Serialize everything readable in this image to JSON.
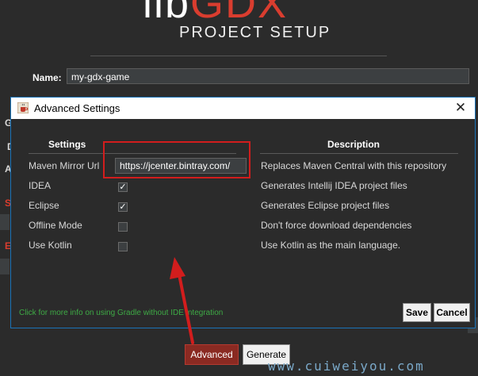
{
  "header": {
    "logo_part1": "lib",
    "logo_part2": "GDX",
    "subtitle": "PROJECT SETUP"
  },
  "form": {
    "name_label": "Name:",
    "name_value": "my-gdx-game",
    "obscured_letters": [
      "G",
      "D",
      "A",
      "S",
      "E"
    ]
  },
  "dialog": {
    "title": "Advanced Settings",
    "close_glyph": "✕",
    "col_settings": "Settings",
    "col_description": "Description",
    "rows": [
      {
        "label": "Maven Mirror Url",
        "value": "https://jcenter.bintray.com/",
        "description": "Replaces Maven Central with this repository"
      },
      {
        "label": "IDEA",
        "checked": true,
        "description": "Generates Intellij IDEA project files"
      },
      {
        "label": "Eclipse",
        "checked": true,
        "description": "Generates Eclipse project files"
      },
      {
        "label": "Offline Mode",
        "checked": false,
        "description": "Don't force download dependencies"
      },
      {
        "label": "Use Kotlin",
        "checked": false,
        "description": "Use Kotlin as the main language."
      }
    ],
    "help_link": "Click for more info on using Gradle without IDE integration",
    "save_label": "Save",
    "cancel_label": "Cancel"
  },
  "bottom": {
    "advanced_label": "Advanced",
    "generate_label": "Generate"
  },
  "watermark": "www.cuiweiyou.com",
  "colors": {
    "accent_red": "#d93d2f",
    "annotation_red": "#d21d1d",
    "link_green": "#3eaa45",
    "dialog_border": "#1a73b8"
  },
  "icons": {
    "title_icon": "java-cup-icon",
    "check_glyph": "✓"
  }
}
